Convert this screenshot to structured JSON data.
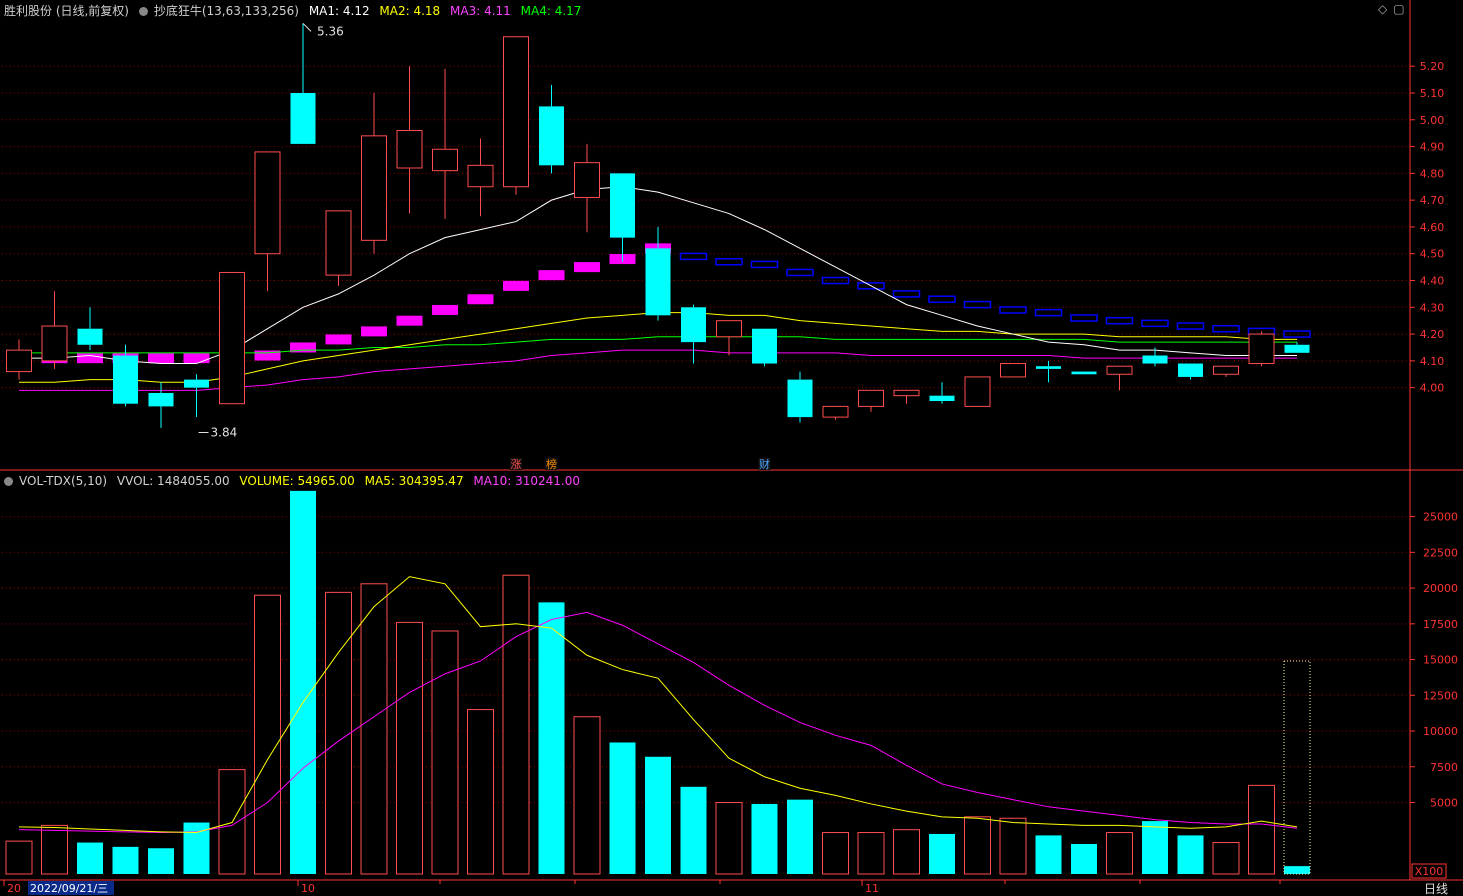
{
  "colors": {
    "up": "#ff4d4d",
    "down": "#00ffff",
    "ma1": "#ffffff",
    "ma2": "#ffff00",
    "ma3": "#ff00ff",
    "ma4": "#00ff00",
    "grid": "#8b0000",
    "axis": "#ff3333",
    "step": "#ff00ff",
    "step2": "#0000ff",
    "dotted": "#ffff99"
  },
  "header": {
    "title": "胜利股份 (日线,前复权)",
    "indicator": "抄底狂牛(13,63,133,256)",
    "ma1": "MA1: 4.12",
    "ma2": "MA2: 4.18",
    "ma3": "MA3: 4.11",
    "ma4": "MA4: 4.17"
  },
  "vol_header": {
    "name": "VOL-TDX(5,10)",
    "vvol": "VVOL: 1484055.00",
    "volume": "VOLUME: 54965.00",
    "ma5": "MA5: 304395.47",
    "ma10": "MA10: 310241.00"
  },
  "annotations": {
    "high": "5.36",
    "low": "3.84",
    "markers": [
      "涨",
      "榜",
      "财"
    ]
  },
  "axis": {
    "unit": "X100",
    "period": "日线",
    "date_label": "2022/09/21/三",
    "x_labels": [
      "20",
      "10",
      "11"
    ]
  },
  "chart_data": [
    {
      "type": "candlestick",
      "ylim": [
        3.7,
        5.38
      ],
      "y_ticks": [
        4.0,
        4.1,
        4.2,
        4.3,
        4.4,
        4.5,
        4.6,
        4.7,
        4.8,
        4.9,
        5.0,
        5.1,
        5.2
      ],
      "candles": [
        {
          "o": 4.06,
          "c": 4.14,
          "h": 4.18,
          "l": 4.03
        },
        {
          "o": 4.1,
          "c": 4.23,
          "h": 4.36,
          "l": 4.07
        },
        {
          "o": 4.22,
          "c": 4.16,
          "h": 4.3,
          "l": 4.14
        },
        {
          "o": 4.12,
          "c": 3.94,
          "h": 4.16,
          "l": 3.93
        },
        {
          "o": 3.98,
          "c": 3.93,
          "h": 4.02,
          "l": 3.85
        },
        {
          "o": 4.03,
          "c": 4.0,
          "h": 4.05,
          "l": 3.89
        },
        {
          "o": 3.94,
          "c": 4.43,
          "h": 4.43,
          "l": 3.94
        },
        {
          "o": 4.5,
          "c": 4.88,
          "h": 4.88,
          "l": 4.36
        },
        {
          "o": 5.1,
          "c": 4.91,
          "h": 5.36,
          "l": 4.91
        },
        {
          "o": 4.42,
          "c": 4.66,
          "h": 4.66,
          "l": 4.38
        },
        {
          "o": 4.55,
          "c": 4.94,
          "h": 5.1,
          "l": 4.5
        },
        {
          "o": 4.82,
          "c": 4.96,
          "h": 5.2,
          "l": 4.65
        },
        {
          "o": 4.81,
          "c": 4.89,
          "h": 5.19,
          "l": 4.63
        },
        {
          "o": 4.75,
          "c": 4.83,
          "h": 4.93,
          "l": 4.64
        },
        {
          "o": 4.75,
          "c": 5.31,
          "h": 5.31,
          "l": 4.72
        },
        {
          "o": 5.05,
          "c": 4.83,
          "h": 5.13,
          "l": 4.8
        },
        {
          "o": 4.71,
          "c": 4.84,
          "h": 4.91,
          "l": 4.58
        },
        {
          "o": 4.8,
          "c": 4.56,
          "h": 4.8,
          "l": 4.47
        },
        {
          "o": 4.52,
          "c": 4.27,
          "h": 4.6,
          "l": 4.25
        },
        {
          "o": 4.3,
          "c": 4.17,
          "h": 4.31,
          "l": 4.09
        },
        {
          "o": 4.19,
          "c": 4.25,
          "h": 4.25,
          "l": 4.12
        },
        {
          "o": 4.22,
          "c": 4.09,
          "h": 4.22,
          "l": 4.08
        },
        {
          "o": 4.03,
          "c": 3.89,
          "h": 4.06,
          "l": 3.87
        },
        {
          "o": 3.89,
          "c": 3.93,
          "h": 3.93,
          "l": 3.88
        },
        {
          "o": 3.93,
          "c": 3.99,
          "h": 3.99,
          "l": 3.91
        },
        {
          "o": 3.97,
          "c": 3.99,
          "h": 3.99,
          "l": 3.94
        },
        {
          "o": 3.97,
          "c": 3.95,
          "h": 4.02,
          "l": 3.94
        },
        {
          "o": 3.93,
          "c": 4.04,
          "h": 4.04,
          "l": 3.93
        },
        {
          "o": 4.04,
          "c": 4.09,
          "h": 4.09,
          "l": 4.04
        },
        {
          "o": 4.08,
          "c": 4.07,
          "h": 4.1,
          "l": 4.02
        },
        {
          "o": 4.06,
          "c": 4.05,
          "h": 4.06,
          "l": 4.05
        },
        {
          "o": 4.05,
          "c": 4.08,
          "h": 4.08,
          "l": 3.99
        },
        {
          "o": 4.12,
          "c": 4.09,
          "h": 4.15,
          "l": 4.08
        },
        {
          "o": 4.09,
          "c": 4.04,
          "h": 4.09,
          "l": 4.03
        },
        {
          "o": 4.05,
          "c": 4.08,
          "h": 4.08,
          "l": 4.04
        },
        {
          "o": 4.09,
          "c": 4.2,
          "h": 4.21,
          "l": 4.08
        },
        {
          "o": 4.16,
          "c": 4.13,
          "h": 4.17,
          "l": 4.13
        }
      ],
      "ma1": [
        4.11,
        4.11,
        4.12,
        4.1,
        4.09,
        4.09,
        4.14,
        4.22,
        4.3,
        4.35,
        4.42,
        4.5,
        4.56,
        4.59,
        4.62,
        4.7,
        4.74,
        4.75,
        4.73,
        4.69,
        4.65,
        4.59,
        4.52,
        4.45,
        4.38,
        4.31,
        4.27,
        4.23,
        4.2,
        4.17,
        4.16,
        4.14,
        4.14,
        4.13,
        4.12,
        4.12,
        4.12
      ],
      "ma2": [
        4.02,
        4.02,
        4.03,
        4.03,
        4.02,
        4.02,
        4.04,
        4.07,
        4.1,
        4.12,
        4.14,
        4.16,
        4.18,
        4.2,
        4.22,
        4.24,
        4.26,
        4.27,
        4.28,
        4.28,
        4.27,
        4.27,
        4.25,
        4.24,
        4.23,
        4.22,
        4.21,
        4.21,
        4.2,
        4.2,
        4.2,
        4.19,
        4.19,
        4.19,
        4.19,
        4.18,
        4.18
      ],
      "ma3": [
        3.99,
        3.99,
        3.99,
        3.99,
        3.99,
        3.99,
        4.0,
        4.01,
        4.03,
        4.04,
        4.06,
        4.07,
        4.08,
        4.09,
        4.1,
        4.12,
        4.13,
        4.14,
        4.14,
        4.14,
        4.13,
        4.13,
        4.13,
        4.13,
        4.12,
        4.12,
        4.12,
        4.12,
        4.12,
        4.12,
        4.11,
        4.11,
        4.11,
        4.11,
        4.11,
        4.11,
        4.11
      ],
      "ma4": [
        4.13,
        4.13,
        4.13,
        4.13,
        4.13,
        4.13,
        4.13,
        4.13,
        4.14,
        4.14,
        4.15,
        4.15,
        4.16,
        4.16,
        4.17,
        4.18,
        4.18,
        4.18,
        4.19,
        4.19,
        4.19,
        4.19,
        4.19,
        4.18,
        4.18,
        4.18,
        4.18,
        4.18,
        4.18,
        4.18,
        4.18,
        4.17,
        4.17,
        4.17,
        4.17,
        4.17,
        4.17
      ],
      "step": [
        4.11,
        4.11,
        4.11,
        4.11,
        4.11,
        4.11,
        4.11,
        4.12,
        4.15,
        4.18,
        4.21,
        4.25,
        4.29,
        4.33,
        4.38,
        4.42,
        4.45,
        4.48,
        4.52,
        4.49,
        4.47,
        4.46,
        4.43,
        4.4,
        4.38,
        4.35,
        4.33,
        4.31,
        4.29,
        4.28,
        4.26,
        4.25,
        4.24,
        4.23,
        4.22,
        4.21,
        4.2
      ],
      "step_color_change_index": 19
    },
    {
      "type": "bar",
      "ylim": [
        0,
        27000
      ],
      "y_ticks": [
        5000,
        7500,
        10000,
        12500,
        15000,
        17500,
        20000,
        22500,
        25000
      ],
      "values": [
        2300,
        3400,
        2200,
        1900,
        1800,
        3600,
        7300,
        19500,
        26800,
        19700,
        20300,
        17600,
        17000,
        11500,
        20900,
        19000,
        11000,
        9200,
        8200,
        6100,
        5000,
        4900,
        5200,
        2900,
        2900,
        3100,
        2800,
        4000,
        3900,
        2700,
        2100,
        2900,
        3700,
        2700,
        2200,
        6200,
        550
      ],
      "ma5": [
        3300,
        3250,
        3150,
        3050,
        2950,
        2900,
        3600,
        8000,
        12000,
        15500,
        18700,
        20800,
        20300,
        17300,
        17500,
        17200,
        15300,
        14300,
        13700,
        10800,
        8100,
        6800,
        6000,
        5500,
        4900,
        4400,
        4000,
        3900,
        3600,
        3500,
        3400,
        3400,
        3300,
        3200,
        3300,
        3700,
        3300
      ],
      "ma10": [
        3100,
        3050,
        3000,
        2950,
        2900,
        2950,
        3400,
        5000,
        7400,
        9300,
        11000,
        12700,
        14000,
        14900,
        16600,
        17800,
        18300,
        17400,
        16100,
        14800,
        13200,
        11800,
        10600,
        9700,
        9000,
        7600,
        6300,
        5700,
        5200,
        4700,
        4400,
        4100,
        3800,
        3600,
        3500,
        3500,
        3200
      ],
      "last_projection": 14900
    }
  ]
}
